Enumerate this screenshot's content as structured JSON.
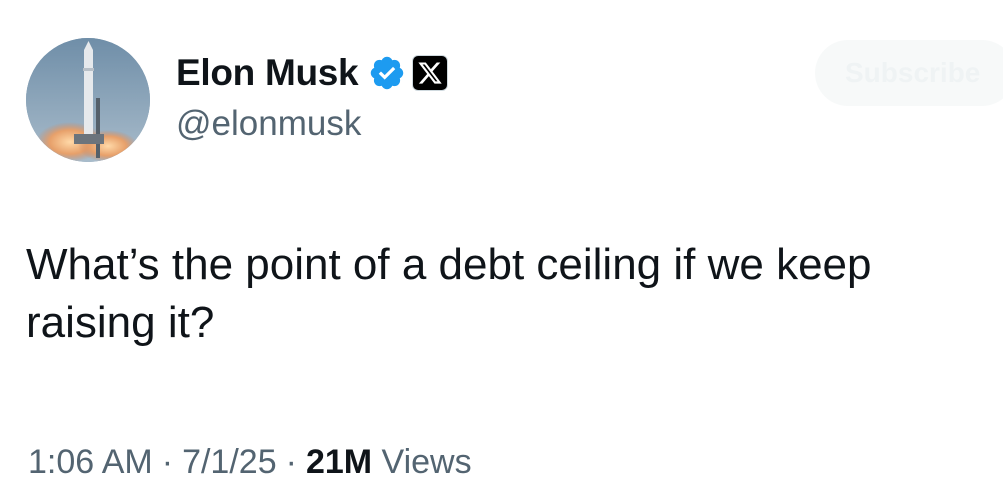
{
  "author": {
    "display_name": "Elon Musk",
    "handle": "@elonmusk",
    "avatar_icon": "rocket-launch-icon",
    "verified_icon": "verified-badge-icon",
    "affiliate_icon": "x-logo-icon",
    "verified_color": "#1d9bf0"
  },
  "subscribe_button": {
    "label": "Subscribe"
  },
  "tweet": {
    "text": "What’s the point of a debt ceiling if we keep raising it?"
  },
  "meta": {
    "time": "1:06 AM",
    "separator": "·",
    "date": "7/1/25",
    "views_count": "21M",
    "views_label": "Views"
  }
}
